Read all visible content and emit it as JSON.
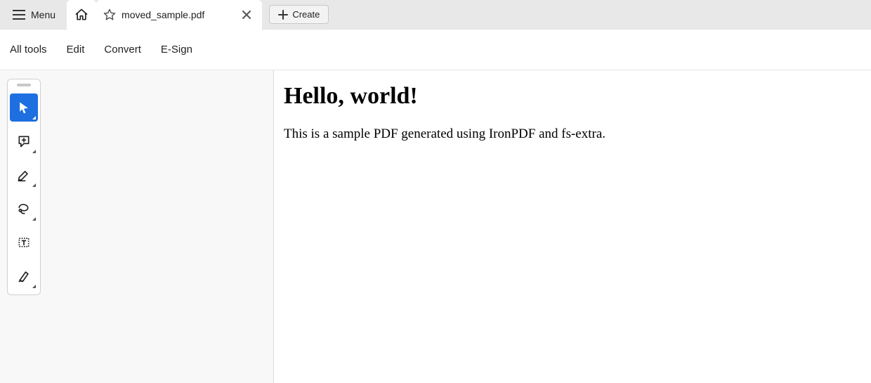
{
  "tabbar": {
    "menu_label": "Menu",
    "file_tab_label": "moved_sample.pdf",
    "create_label": "Create"
  },
  "menubar": {
    "items": [
      "All tools",
      "Edit",
      "Convert",
      "E-Sign"
    ]
  },
  "tools": {
    "items": [
      {
        "name": "select-tool",
        "active": true
      },
      {
        "name": "comment-tool",
        "active": false
      },
      {
        "name": "highlight-tool",
        "active": false
      },
      {
        "name": "draw-tool",
        "active": false
      },
      {
        "name": "textbox-tool",
        "active": false
      },
      {
        "name": "sign-tool",
        "active": false
      }
    ]
  },
  "document": {
    "heading": "Hello, world!",
    "body": "This is a sample PDF generated using IronPDF and fs-extra."
  }
}
